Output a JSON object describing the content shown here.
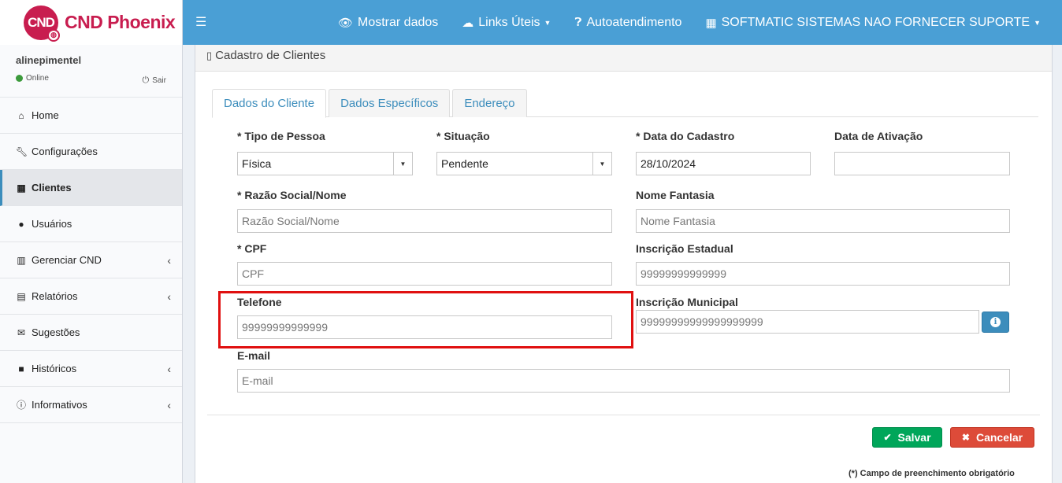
{
  "app": {
    "logo_badge": "CND",
    "logo_text": "CND Phoenix"
  },
  "user": {
    "name": "alinepimentel",
    "status": "Online",
    "logout": "Sair"
  },
  "sidebar": {
    "items": [
      {
        "label": "Home"
      },
      {
        "label": "Configurações"
      },
      {
        "label": "Clientes"
      },
      {
        "label": "Usuários"
      },
      {
        "label": "Gerenciar CND"
      },
      {
        "label": "Relatórios"
      },
      {
        "label": "Sugestões"
      },
      {
        "label": "Históricos"
      },
      {
        "label": "Informativos"
      }
    ]
  },
  "topbar": {
    "show_data": "Mostrar dados",
    "links": "Links Úteis",
    "self_service": "Autoatendimento",
    "company": "SOFTMATIC SISTEMAS NAO FORNECER SUPORTE"
  },
  "page": {
    "title": "Cadastro de Clientes"
  },
  "tabs": [
    "Dados do Cliente",
    "Dados Específicos",
    "Endereço"
  ],
  "form": {
    "tipo_pessoa": {
      "label": "* Tipo de Pessoa",
      "value": "Física"
    },
    "situacao": {
      "label": "* Situação",
      "value": "Pendente"
    },
    "data_cadastro": {
      "label": "* Data do Cadastro",
      "value": "28/10/2024"
    },
    "data_ativacao": {
      "label": "Data de Ativação",
      "value": ""
    },
    "razao_social": {
      "label": "* Razão Social/Nome",
      "placeholder": "Razão Social/Nome"
    },
    "nome_fantasia": {
      "label": "Nome Fantasia",
      "placeholder": "Nome Fantasia"
    },
    "cpf": {
      "label": "* CPF",
      "placeholder": "CPF"
    },
    "inscricao_estadual": {
      "label": "Inscrição Estadual",
      "placeholder": "99999999999999"
    },
    "telefone": {
      "label": "Telefone",
      "placeholder": "99999999999999"
    },
    "inscricao_municipal": {
      "label": "Inscrição Municipal",
      "placeholder": "99999999999999999999"
    },
    "email": {
      "label": "E-mail",
      "placeholder": "E-mail"
    }
  },
  "actions": {
    "save": "Salvar",
    "cancel": "Cancelar"
  },
  "footnote": "(*) Campo de preenchimento obrigatório",
  "colors": {
    "accent": "#4a9fd5",
    "brand": "#c81d4f",
    "save": "#00a65a",
    "cancel": "#dd4b39",
    "highlight": "#e01010"
  }
}
